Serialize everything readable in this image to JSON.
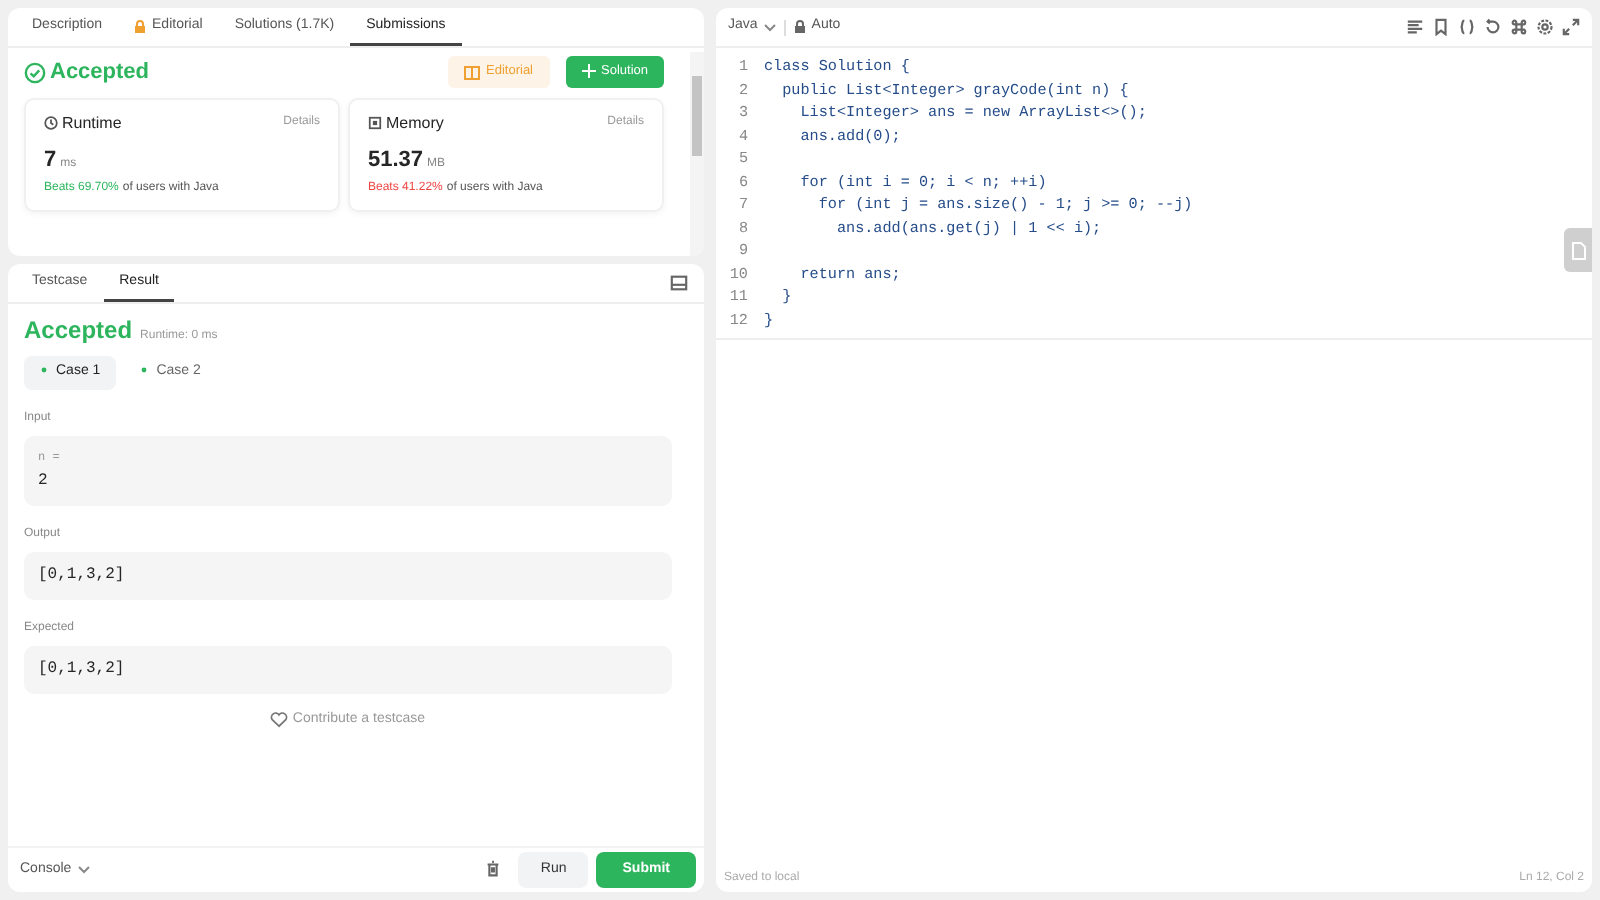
{
  "left_tabs": [
    {
      "label": "Description",
      "locked": false,
      "selected": false
    },
    {
      "label": "Editorial",
      "locked": true,
      "selected": false
    },
    {
      "label": "Solutions (1.7K)",
      "locked": false,
      "selected": false
    },
    {
      "label": "Submissions",
      "locked": false,
      "selected": true
    }
  ],
  "submission": {
    "status": "Accepted",
    "editorial_button": "Editorial",
    "solution_button": "Solution",
    "metrics": [
      {
        "kind": "runtime",
        "label": "Runtime",
        "details": "Details",
        "value": "7",
        "unit": "ms",
        "beats": "Beats 69.70%",
        "rest": "of users with Java",
        "color": "#2db55d"
      },
      {
        "kind": "memory",
        "label": "Memory",
        "details": "Details",
        "value": "51.37",
        "unit": "MB",
        "beats": "Beats 41.22%",
        "rest": "of users with Java",
        "color": "#ef4743"
      }
    ]
  },
  "bottom_tabs": [
    {
      "label": "Testcase",
      "selected": false
    },
    {
      "label": "Result",
      "selected": true
    }
  ],
  "result": {
    "status": "Accepted",
    "runtime": "Runtime: 0 ms",
    "cases": [
      {
        "label": "Case 1",
        "selected": true
      },
      {
        "label": "Case 2",
        "selected": false
      }
    ],
    "sections": [
      {
        "label": "Input",
        "variable": "n =",
        "value": "2"
      },
      {
        "label": "Output",
        "value": "[0,1,3,2]"
      },
      {
        "label": "Expected",
        "value": "[0,1,3,2]"
      }
    ],
    "contribute": "Contribute a testcase"
  },
  "footer": {
    "console": "Console",
    "run": "Run",
    "submit": "Submit"
  },
  "editor": {
    "language": "Java",
    "mode": "Auto",
    "lines": [
      {
        "number": "1",
        "code": "class Solution {"
      },
      {
        "number": "2",
        "code": "  public List<Integer> grayCode(int n) {"
      },
      {
        "number": "3",
        "code": "    List<Integer> ans = new ArrayList<>();"
      },
      {
        "number": "4",
        "code": "    ans.add(0);"
      },
      {
        "number": "5"
      },
      {
        "number": "6",
        "code": "    for (int i = 0; i < n; ++i)"
      },
      {
        "number": "7",
        "code": "      for (int j = ans.size() - 1; j >= 0; --j)"
      },
      {
        "number": "8",
        "code": "        ans.add(ans.get(j) | 1 << i);"
      },
      {
        "number": "9"
      },
      {
        "number": "10",
        "code": "    return ans;"
      },
      {
        "number": "11",
        "code": "  }"
      },
      {
        "number": "12",
        "code": "}"
      }
    ],
    "saved": "Saved to local",
    "position": "Ln 12, Col 2"
  }
}
